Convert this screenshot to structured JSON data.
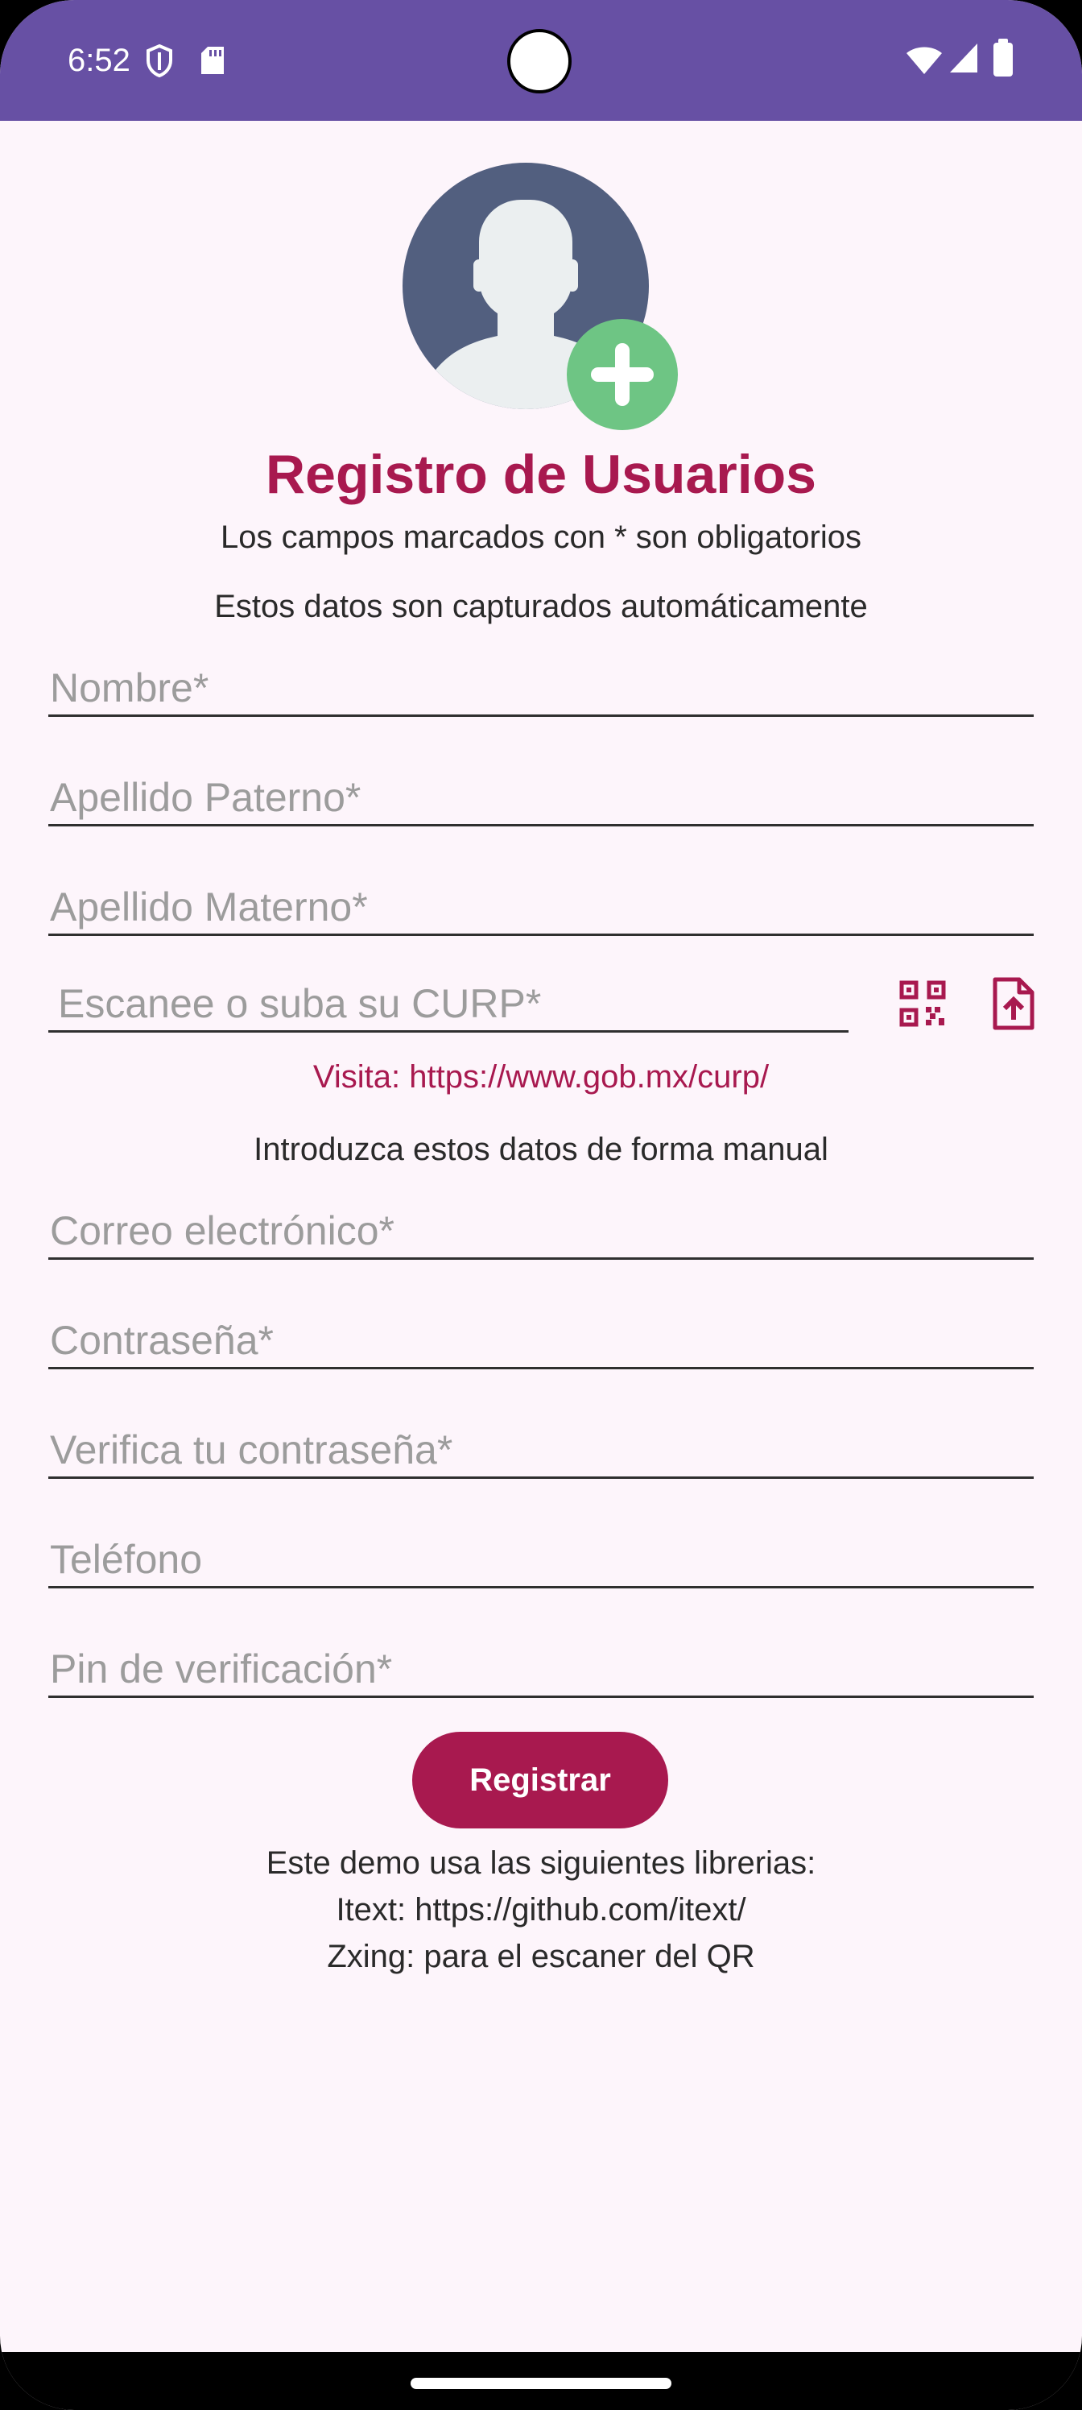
{
  "status_bar": {
    "time": "6:52",
    "icons": [
      "shield-icon",
      "sd-card-icon",
      "wifi-icon",
      "signal-icon",
      "battery-icon"
    ],
    "background_color": "#6750a4"
  },
  "avatar": {
    "icon": "person-avatar-icon",
    "add_icon": "add-photo-icon",
    "circle_color": "#525f7f",
    "add_color": "#6ec584"
  },
  "header": {
    "title": "Registro de Usuarios",
    "required_note": "Los campos marcados con * son obligatorios",
    "auto_captured_note": "Estos datos son capturados automáticamente"
  },
  "auto_fields": {
    "nombre_placeholder": "Nombre*",
    "apellido_paterno_placeholder": "Apellido Paterno*",
    "apellido_materno_placeholder": "Apellido Materno*",
    "curp_placeholder": "Escanee o suba su CURP*",
    "scan_icon": "qr-scan-icon",
    "upload_icon": "file-upload-icon"
  },
  "curp_link": "Visita: https://www.gob.mx/curp/",
  "manual_note": "Introduzca estos datos de forma manual",
  "manual_fields": {
    "correo_placeholder": "Correo electrónico*",
    "contrasena_placeholder": "Contraseña*",
    "verifica_placeholder": "Verifica tu contraseña*",
    "telefono_placeholder": "Teléfono",
    "pin_placeholder": "Pin de verificación*"
  },
  "register_button": "Registrar",
  "footer": {
    "line1": "Este demo usa las siguientes librerias:",
    "line2": "Itext: https://github.com/itext/",
    "line3": "Zxing: para el escaner del QR"
  },
  "colors": {
    "accent": "#a8194f",
    "background": "#fdf5fb"
  }
}
